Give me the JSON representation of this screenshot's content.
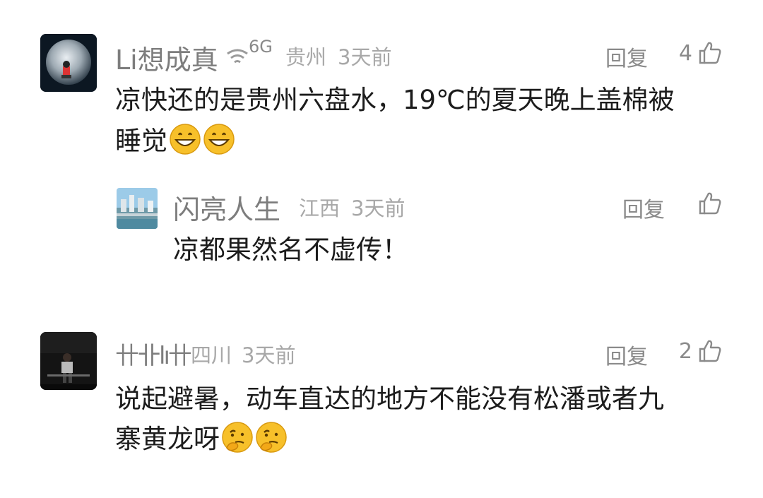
{
  "comments": [
    {
      "username": "Li想成真",
      "signal_text": "6G",
      "region": "贵州",
      "time": "3天前",
      "reply_label": "回复",
      "likes": "4",
      "text_line1": "凉快还的是贵州六盘水，19℃的夏天晚上盖棉被",
      "text_line2": "睡觉",
      "emoji": "grinning-face-emoji"
    },
    {
      "username": "闪亮人生",
      "region": "江西",
      "time": "3天前",
      "reply_label": "回复",
      "likes": "",
      "text_line1": "凉都果然名不虚传！"
    },
    {
      "username": "卄卝lı卄",
      "region": "四川",
      "time": "3天前",
      "reply_label": "回复",
      "likes": "2",
      "text_line1": "说起避暑，动车直达的地方不能没有松潘或者九",
      "text_line2": "寨黄龙呀",
      "emoji": "thinking-face-emoji"
    }
  ],
  "icons": {
    "like": "thumbs-up-icon",
    "signal": "wifi-signal-icon"
  }
}
